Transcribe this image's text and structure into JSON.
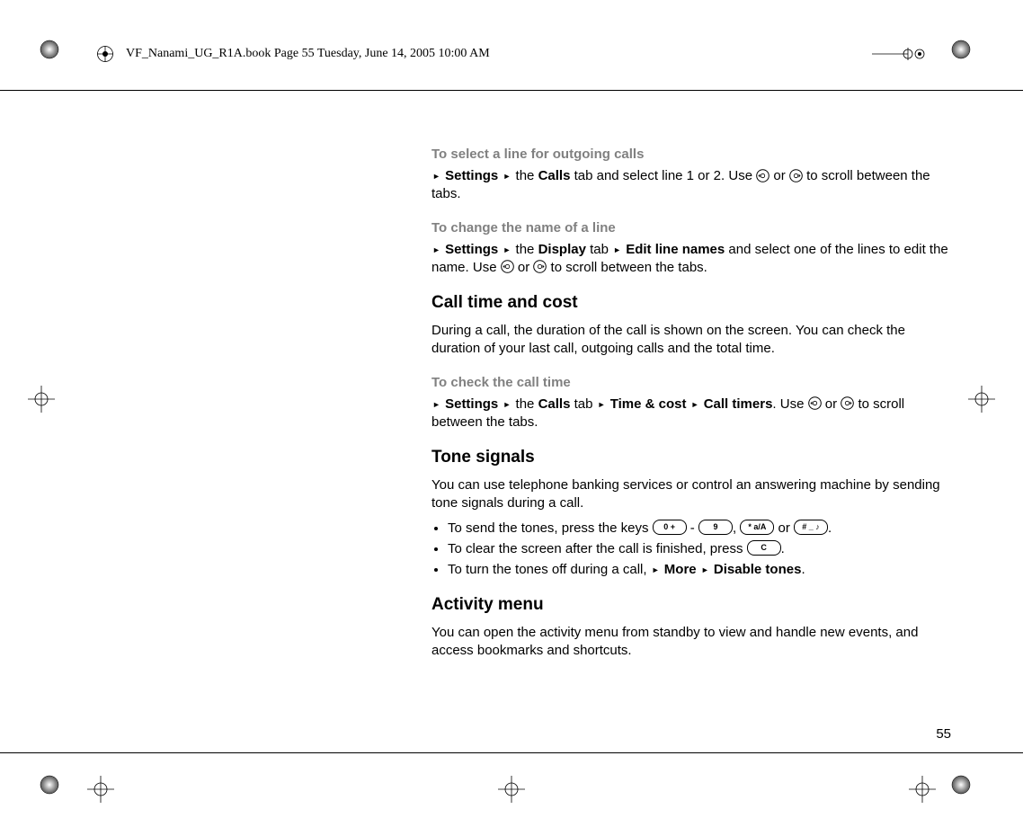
{
  "header": {
    "filename_line": "VF_Nanami_UG_R1A.book  Page 55  Tuesday, June 14, 2005  10:00 AM"
  },
  "page_number": "55",
  "sections": {
    "s1_title": "To select a line for outgoing calls",
    "s1_pre": "Settings",
    "s1_mid": " the ",
    "s1_calls": "Calls",
    "s1_rest_a": " tab and select line 1 or 2. Use ",
    "s1_or": " or ",
    "s1_rest_b": " to scroll between the tabs.",
    "s2_title": "To change the name of a line",
    "s2_settings": "Settings",
    "s2_the": " the ",
    "s2_display": "Display",
    "s2_tab": " tab ",
    "s2_edit": "Edit line names",
    "s2_rest_a": " and select one of the lines to edit the name. Use ",
    "s2_or": " or ",
    "s2_rest_b": " to scroll between the tabs.",
    "h2_cost": "Call time and cost",
    "p_cost": "During a call, the duration of the call is shown on the screen. You can check the duration of your last call, outgoing calls and the total time.",
    "s3_title": "To check the call time",
    "s3_settings": "Settings",
    "s3_the": " the ",
    "s3_calls": "Calls",
    "s3_tab": " tab ",
    "s3_time": "Time & cost",
    "s3_timers": "Call timers",
    "s3_use": ". Use ",
    "s3_or": " or ",
    "s3_rest": " to scroll between the tabs.",
    "h2_tone": "Tone signals",
    "p_tone": "You can use telephone banking services or control an answering machine by sending tone signals during a call.",
    "li1_a": "To send the tones, press the keys ",
    "li1_dash": " - ",
    "li1_comma": ", ",
    "li1_or": " or ",
    "li1_dot": ".",
    "li2_a": "To clear the screen after the call is finished, press ",
    "li2_dot": ".",
    "li3_a": "To turn the tones off during a call, ",
    "li3_more": "More",
    "li3_disable": "Disable tones",
    "li3_dot": ".",
    "h2_activity": "Activity menu",
    "p_activity": "You can open the activity menu from standby to view and handle new events, and access bookmarks and shortcuts."
  },
  "keys": {
    "zero": "0 +",
    "nine": "9",
    "star": "* a/A",
    "hash": "# _ ♪",
    "c": "C"
  }
}
